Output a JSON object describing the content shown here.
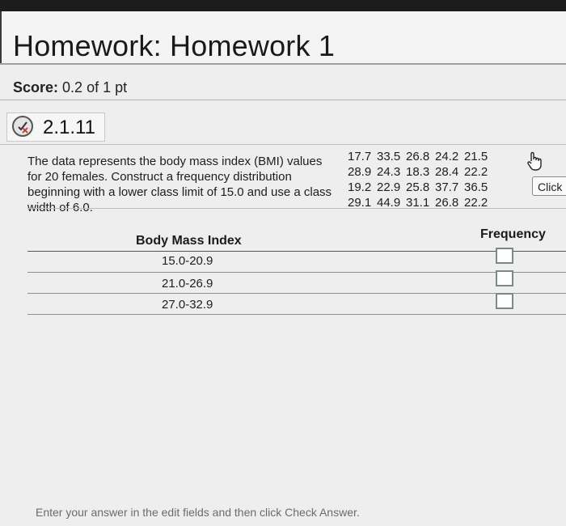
{
  "header": {
    "title": "Homework: Homework 1"
  },
  "score": {
    "label": "Score:",
    "value": "0.2 of 1 pt"
  },
  "question": {
    "number": "2.1.11",
    "status_icon": "partially-correct-icon"
  },
  "problem": {
    "text": "The data represents the body mass index (BMI) values for 20 females. Construct a frequency distribution beginning with a lower class limit of 15.0 and use a class width of 6.0."
  },
  "data_values": [
    [
      "17.7",
      "33.5",
      "26.8",
      "24.2",
      "21.5"
    ],
    [
      "28.9",
      "24.3",
      "18.3",
      "28.4",
      "22.2"
    ],
    [
      "19.2",
      "22.9",
      "25.8",
      "37.7",
      "36.5"
    ],
    [
      "29.1",
      "44.9",
      "31.1",
      "26.8",
      "22.2"
    ]
  ],
  "click_button": {
    "label": "Click"
  },
  "table": {
    "col_body": "Body Mass Index",
    "col_freq": "Frequency",
    "rows": [
      {
        "label": "15.0-20.9",
        "value": ""
      },
      {
        "label": "21.0-26.9",
        "value": ""
      },
      {
        "label": "27.0-32.9",
        "value": ""
      }
    ]
  },
  "footer": {
    "text": "Enter your answer in the edit fields and then click Check Answer."
  },
  "colors": {
    "topbar": "#1c1c1c",
    "background": "#eeeeee",
    "input_border": "#7a8a8a"
  }
}
